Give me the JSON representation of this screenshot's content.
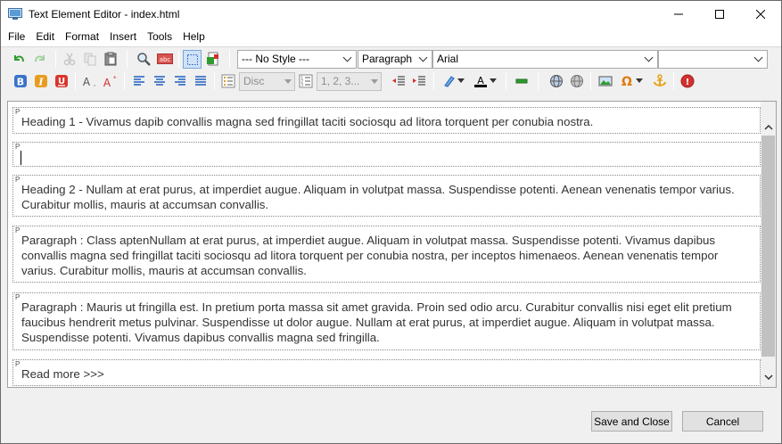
{
  "window": {
    "title": "Text Element Editor - index.html",
    "minimize_label": "—",
    "maximize_label": "☐",
    "close_label": "✕"
  },
  "menu": {
    "items": [
      "File",
      "Edit",
      "Format",
      "Insert",
      "Tools",
      "Help"
    ]
  },
  "toolbar": {
    "style_select": "--- No Style ---",
    "block_select": "Paragraph",
    "font_select": "Arial",
    "size_select": "",
    "list_style_select": "Disc",
    "numbering_select": "1, 2, 3..."
  },
  "document": {
    "block_tag": "P",
    "blocks": [
      "Heading 1 - Vivamus dapib convallis magna sed fringillat taciti sociosqu ad litora torquent per conubia nostra.",
      "",
      "Heading 2 - Nullam at erat purus, at imperdiet augue. Aliquam in volutpat massa. Suspendisse potenti. Aenean venenatis tempor varius. Curabitur mollis, mauris at accumsan convallis.",
      "Paragraph : Class aptenNullam at erat purus, at imperdiet augue. Aliquam in volutpat massa. Suspendisse potenti. Vivamus dapibus convallis magna sed fringillat taciti sociosqu ad litora torquent per conubia nostra, per inceptos himenaeos. Aenean venenatis tempor varius. Curabitur mollis, mauris at accumsan convallis.",
      "Paragraph : Mauris ut fringilla est. In pretium porta massa sit amet gravida. Proin sed odio arcu. Curabitur convallis nisi eget elit pretium faucibus hendrerit metus pulvinar. Suspendisse ut dolor augue. Nullam at erat purus, at imperdiet augue. Aliquam in volutpat massa. Suspendisse potenti. Vivamus dapibus convallis magna sed fringilla.",
      "Read more >>>"
    ]
  },
  "buttons": {
    "save_close": "Save and Close",
    "cancel": "Cancel"
  },
  "colors": {
    "accent_blue": "#1f5fbf",
    "undo_green": "#2e9b2e",
    "error_red": "#d32f2f"
  }
}
